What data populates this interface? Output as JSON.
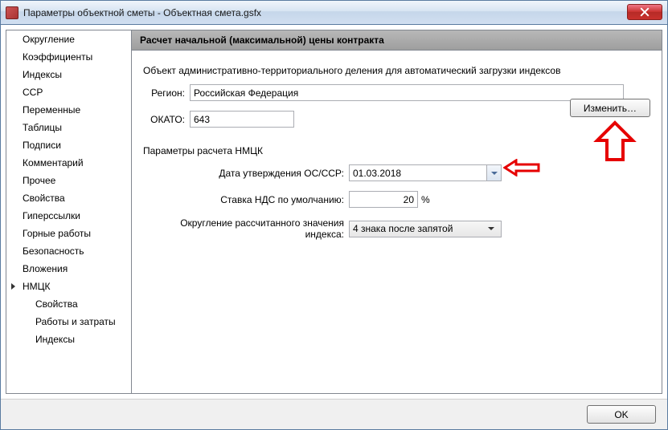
{
  "window": {
    "title": "Параметры объектной сметы - Объектная смета.gsfx"
  },
  "sidebar": {
    "items": [
      {
        "label": "Округление"
      },
      {
        "label": "Коэффициенты"
      },
      {
        "label": "Индексы"
      },
      {
        "label": "ССР"
      },
      {
        "label": "Переменные"
      },
      {
        "label": "Таблицы"
      },
      {
        "label": "Подписи"
      },
      {
        "label": "Комментарий"
      },
      {
        "label": "Прочее"
      },
      {
        "label": "Свойства"
      },
      {
        "label": "Гиперссылки"
      },
      {
        "label": "Горные работы"
      },
      {
        "label": "Безопасность"
      },
      {
        "label": "Вложения"
      },
      {
        "label": "НМЦК",
        "selected": true
      }
    ],
    "subitems": [
      {
        "label": "Свойства"
      },
      {
        "label": "Работы и затраты"
      },
      {
        "label": "Индексы"
      }
    ]
  },
  "content": {
    "header": "Расчет начальной (максимальной) цены контракта",
    "section1_label": "Объект административно-территориального деления для автоматический загрузки индексов",
    "region_label": "Регион:",
    "region_value": "Российская Федерация",
    "okato_label": "ОКАТО:",
    "okato_value": "643",
    "change_button": "Изменить…",
    "section2_label": "Параметры расчета НМЦК",
    "date_label": "Дата утверждения ОС/ССР:",
    "date_value": "01.03.2018",
    "vat_label": "Ставка НДС по умолчанию:",
    "vat_value": "20",
    "vat_percent": "%",
    "rounding_label": "Округление рассчитанного значения индекса:",
    "rounding_value": "4 знака после запятой"
  },
  "footer": {
    "ok_label": "OK"
  }
}
